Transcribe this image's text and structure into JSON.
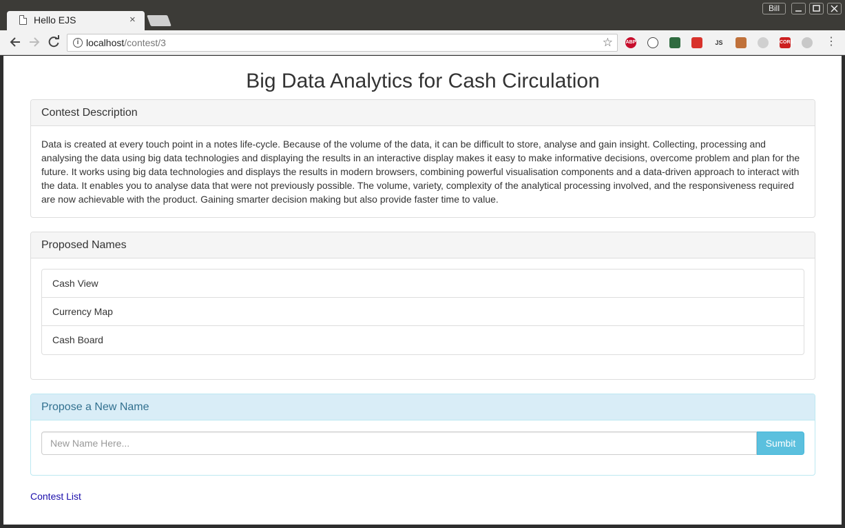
{
  "browser": {
    "tab_title": "Hello EJS",
    "tab_close": "×",
    "user_label": "Bill",
    "url_host": "localhost",
    "url_path": "/contest/3",
    "extensions": [
      {
        "name": "abp-extension-icon",
        "label": "ABP",
        "color": "#c70d2c"
      },
      {
        "name": "sync-extension-icon",
        "label": "",
        "color": "#ffffff"
      },
      {
        "name": "color-extension-icon",
        "label": "",
        "color": "#2f6b3f"
      },
      {
        "name": "red-extension-icon",
        "label": "",
        "color": "#d8322b"
      },
      {
        "name": "js-extension-icon",
        "label": "JS",
        "color": "#6aa84f"
      },
      {
        "name": "monkey-extension-icon",
        "label": "",
        "color": "#c0713a"
      },
      {
        "name": "gray-extension-icon",
        "label": "",
        "color": "#d0d0d0"
      },
      {
        "name": "cors-extension-icon",
        "label": "CORS",
        "color": "#cc1f1f"
      },
      {
        "name": "moon-extension-icon",
        "label": "",
        "color": "#c8c8c8"
      }
    ]
  },
  "page": {
    "title": "Big Data Analytics for Cash Circulation",
    "description_heading": "Contest Description",
    "description_text": "Data is created at every touch point in a notes life-cycle. Because of the volume of the data, it can be difficult to store, analyse and gain insight. Collecting, processing and analysing the data using big data technologies and displaying the results in an interactive display makes it easy to make informative decisions, overcome problem and plan for the future. It works using big data technologies and displays the results in modern browsers, combining powerful visualisation components and a data-driven approach to interact with the data. It enables you to analyse data that were not previously possible. The volume, variety, complexity of the analytical processing involved, and the responsiveness required are now achievable with the product. Gaining smarter decision making but also provide faster time to value.",
    "names_heading": "Proposed Names",
    "names": [
      "Cash View",
      "Currency Map",
      "Cash Board"
    ],
    "propose_heading": "Propose a New Name",
    "input_placeholder": "New Name Here...",
    "submit_label": "Sumbit",
    "contest_list_link": "Contest List"
  }
}
